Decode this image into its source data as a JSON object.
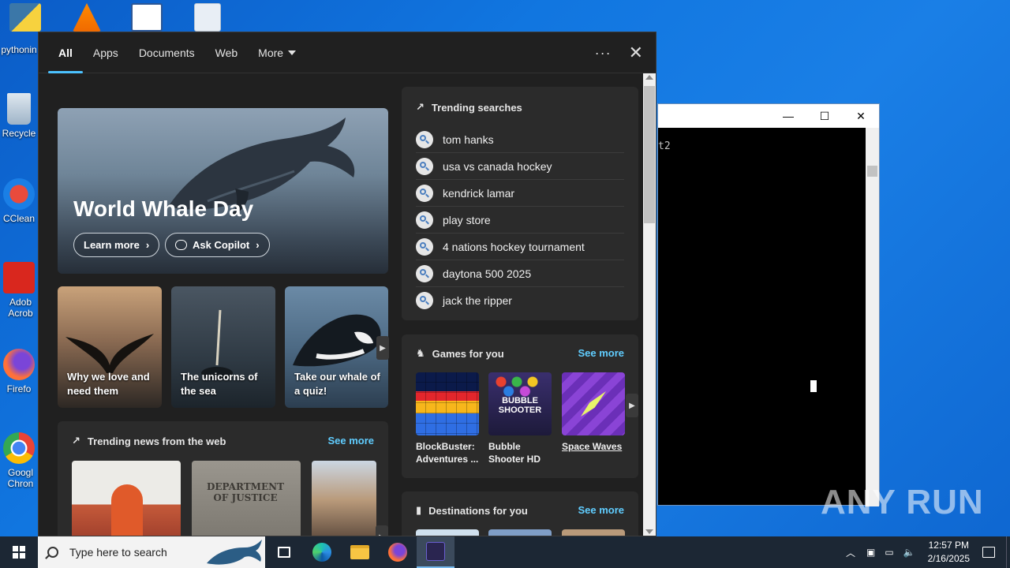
{
  "desktop": {
    "icons": [
      {
        "label": "pythonin"
      },
      {
        "label": "Recycle"
      },
      {
        "label": "CClean"
      },
      {
        "label": "Adob Acrob"
      },
      {
        "label": "Firefo"
      },
      {
        "label": "Googl Chron"
      }
    ]
  },
  "terminal": {
    "text": "t2",
    "controls": {
      "minimize": "—",
      "maximize": "☐",
      "close": "✕"
    }
  },
  "search_panel": {
    "tabs": [
      {
        "label": "All",
        "active": true
      },
      {
        "label": "Apps"
      },
      {
        "label": "Documents"
      },
      {
        "label": "Web"
      },
      {
        "label": "More"
      }
    ],
    "options_label": "···",
    "close_label": "✕",
    "hero": {
      "title": "World Whale Day",
      "learn_more": "Learn more",
      "ask_copilot": "Ask Copilot"
    },
    "cards": [
      {
        "caption": "Why we love and need them"
      },
      {
        "caption": "The unicorns of the sea"
      },
      {
        "caption": "Take our whale of a quiz!"
      }
    ],
    "news": {
      "title": "Trending news from the web",
      "see_more": "See more",
      "doj_text": "DEPARTMENT OF JUSTICE"
    },
    "trending": {
      "title": "Trending searches",
      "items": [
        "tom hanks",
        "usa vs canada hockey",
        "kendrick lamar",
        "play store",
        "4 nations hockey tournament",
        "daytona 500 2025",
        "jack the ripper"
      ]
    },
    "games": {
      "title": "Games for you",
      "see_more": "See more",
      "items": [
        {
          "label": "BlockBuster: Adventures ..."
        },
        {
          "label": "Bubble Shooter HD",
          "art_text": "BUBBLE SHOOTER"
        },
        {
          "label": "Space Waves"
        }
      ]
    },
    "destinations": {
      "title": "Destinations for you",
      "see_more": "See more"
    }
  },
  "taskbar": {
    "search_placeholder": "Type here to search",
    "time": "12:57 PM",
    "date": "2/16/2025",
    "watermark": "ANY RUN"
  },
  "colors": {
    "accent": "#4cc2ff",
    "link": "#60cdff",
    "panel_bg": "#202020",
    "card_bg": "#2b2b2b",
    "desktop": "#1176e0"
  }
}
